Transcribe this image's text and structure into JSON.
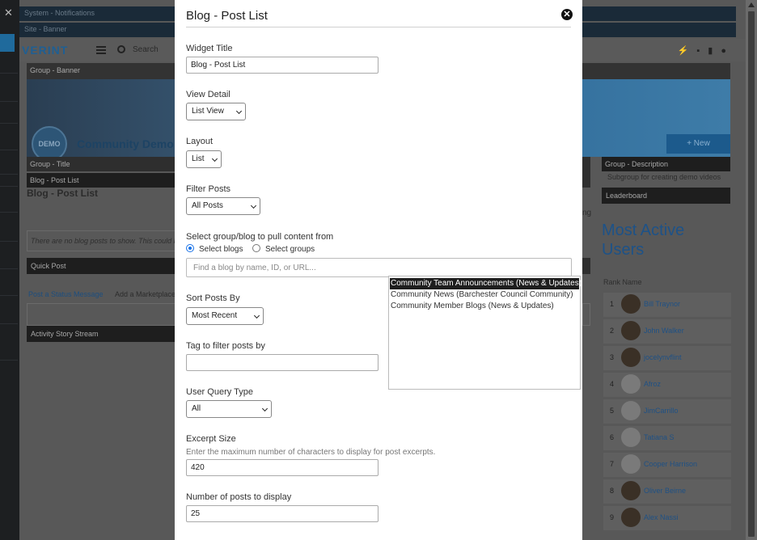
{
  "background": {
    "system_notifications": "System - Notifications",
    "site_banner": "Site - Banner",
    "brand": "VERINT",
    "search_placeholder": "Search",
    "group_banner": "Group - Banner",
    "demo_badge": "DEMO",
    "community_name": "Community Demo",
    "new_button": "+ New",
    "group_title": "Group - Title",
    "blog_post_list": "Blog - Post List",
    "page_heading": "Blog - Post List",
    "empty_message": "There are no blog posts to show. This could b",
    "quick_post": "Quick Post",
    "post_status": "Post a Status Message",
    "add_marketplace": "Add a Marketplace",
    "activity_stream": "Activity Story Stream",
    "group_description": "Group - Description",
    "description_text": "Subgroup for creating demo videos",
    "leaderboard": "Leaderboard",
    "ng_fragment": "ng",
    "most_active_users": "Most Active Users",
    "col_rank": "Rank",
    "col_name": "Name",
    "leaders": [
      {
        "rank": "1",
        "name": "Bill Traynor"
      },
      {
        "rank": "2",
        "name": "John Walker"
      },
      {
        "rank": "3",
        "name": "jocelynvflint"
      },
      {
        "rank": "4",
        "name": "Afroz"
      },
      {
        "rank": "5",
        "name": "JimCarrillo"
      },
      {
        "rank": "6",
        "name": "Tatiana S"
      },
      {
        "rank": "7",
        "name": "Cooper Harrison"
      },
      {
        "rank": "8",
        "name": "Oliver Beirne"
      },
      {
        "rank": "9",
        "name": "Alex Nassi"
      }
    ]
  },
  "modal": {
    "title": "Blog - Post List",
    "widget_title_label": "Widget Title",
    "widget_title_value": "Blog - Post List",
    "view_detail_label": "View Detail",
    "view_detail_value": "List View",
    "layout_label": "Layout",
    "layout_value": "List",
    "filter_posts_label": "Filter Posts",
    "filter_posts_value": "All Posts",
    "select_source_label": "Select group/blog to pull content from",
    "select_blogs_label": "Select blogs",
    "select_groups_label": "Select groups",
    "blog_search_placeholder": "Find a blog by name, ID, or URL...",
    "blog_options": [
      "Community Team Announcements (News & Updates)",
      "Community News (Barchester Council Community)",
      "Community Member Blogs (News & Updates)"
    ],
    "sort_label": "Sort Posts By",
    "sort_value": "Most Recent",
    "tag_label": "Tag to filter posts by",
    "tag_value": "",
    "query_type_label": "User Query Type",
    "query_type_value": "All",
    "excerpt_label": "Excerpt Size",
    "excerpt_help": "Enter the maximum number of characters to display for post excerpts.",
    "excerpt_value": "420",
    "num_posts_label": "Number of posts to display",
    "num_posts_value": "25"
  }
}
